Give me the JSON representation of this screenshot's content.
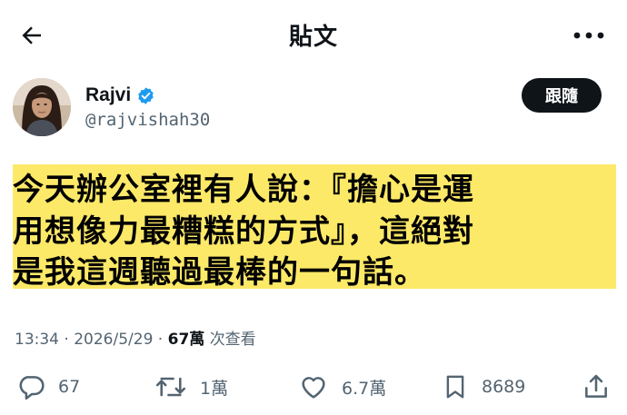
{
  "header": {
    "title": "貼文",
    "back_icon": "arrow-left-icon",
    "more_icon": "more-horizontal-icon"
  },
  "author": {
    "name": "Rajvi",
    "handle": "@rajvishah30",
    "verified": true,
    "verified_color": "#1d9bf0",
    "follow_label": "跟隨"
  },
  "tweet": {
    "highlight_color": "#fde968",
    "lines": [
      "今天辦公室裡有人說：『擔心是運",
      "用想像力最糟糕的方式』，這絕對",
      "是我這週聽過最棒的一句話。"
    ]
  },
  "meta": {
    "time": "13:34",
    "separator": " · ",
    "date": "2026/5/29",
    "views_count": "67萬",
    "views_label": "次查看"
  },
  "actions": {
    "reply": {
      "icon": "reply-icon",
      "count": "67"
    },
    "retweet": {
      "icon": "retweet-icon",
      "count": "1萬"
    },
    "like": {
      "icon": "heart-icon",
      "count": "6.7萬"
    },
    "bookmark": {
      "icon": "bookmark-icon",
      "count": "8689"
    },
    "share": {
      "icon": "share-icon"
    }
  }
}
